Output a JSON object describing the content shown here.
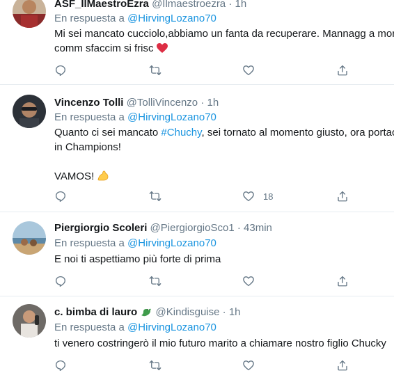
{
  "tweets": [
    {
      "name": "ASF_IlMaestroEzra",
      "handle": "@Ilmaestroezra",
      "dot": "·",
      "time": "1h",
      "reply_prefix": "En respuesta a ",
      "reply_to": "@HirvingLozano70",
      "line1": "Mi sei mancato cucciolo,abbiamo un fanta da recuperare. Mannagg a mor",
      "line2": "comm sfaccim si frisc",
      "like_count": ""
    },
    {
      "name": "Vincenzo Tolli",
      "handle": "@TolliVincenzo",
      "dot": "·",
      "time": "1h",
      "reply_prefix": "En respuesta a ",
      "reply_to": "@HirvingLozano70",
      "line1_a": "Quanto ci sei mancato ",
      "hashtag": "#Chuchy",
      "line1_b": ", sei tornato al momento giusto, ora portac",
      "line2": "in Champions!",
      "line3": "VAMOS!",
      "like_count": "18"
    },
    {
      "name": "Piergiorgio Scoleri",
      "handle": "@PiergiorgioSco1",
      "dot": "·",
      "time": "43min",
      "reply_prefix": "En respuesta a ",
      "reply_to": "@HirvingLozano70",
      "line1": "E noi ti aspettiamo più forte di prima",
      "like_count": ""
    },
    {
      "name": "c. bimba di lauro",
      "handle": "@Kindisguise",
      "dot": "·",
      "time": "1h",
      "reply_prefix": "En respuesta a ",
      "reply_to": "@HirvingLozano70",
      "line1": "ti venero costringerò il mio futuro marito a chiamare nostro figlio Chucky",
      "like_count": ""
    }
  ],
  "icons": {
    "reply": "reply-icon",
    "retweet": "retweet-icon",
    "like": "heart-icon",
    "share": "share-icon"
  },
  "colors": {
    "link": "#1b95e0",
    "secondary": "#657786",
    "heart": "#e0245e",
    "divider": "#e6ecf0"
  }
}
